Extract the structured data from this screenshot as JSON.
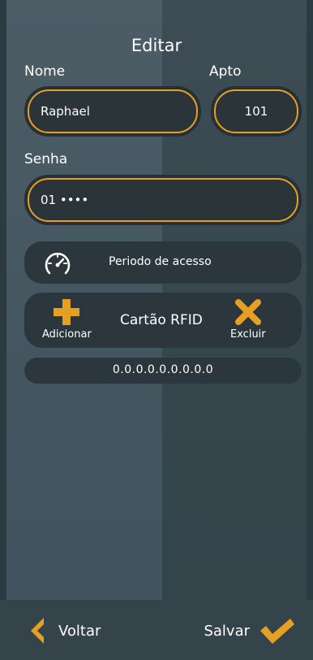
{
  "header": {
    "title": "Editar"
  },
  "form": {
    "name_label": "Nome",
    "name_value": "Raphael",
    "apt_label": "Apto",
    "apt_value": "101",
    "password_label": "Senha",
    "password_value": "01 ••••"
  },
  "access": {
    "label": "Periodo de acesso",
    "icon": "speedometer-icon"
  },
  "rfid": {
    "label": "Cartão RFID",
    "add_label": "Adicionar",
    "delete_label": "Excluir",
    "code": "0.0.0.0.0.0.0.0.0"
  },
  "footer": {
    "back_label": "Voltar",
    "save_label": "Salvar"
  },
  "colors": {
    "accent": "#e6a021",
    "field_bg": "#2b3439",
    "pill_bg": "#2c373d",
    "footer_bg": "#35434a"
  }
}
